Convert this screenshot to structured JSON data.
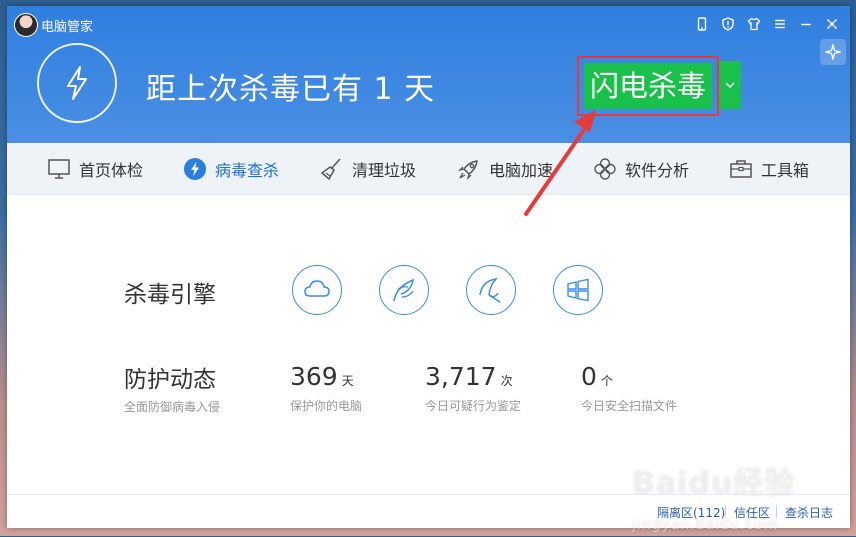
{
  "app": {
    "title": "电脑管家"
  },
  "status": {
    "text": "距上次杀毒已有 1 天"
  },
  "primary_action": {
    "label": "闪电杀毒"
  },
  "nav": [
    {
      "label": "首页体检",
      "icon": "monitor-icon"
    },
    {
      "label": "病毒查杀",
      "icon": "lightning-icon",
      "active": true
    },
    {
      "label": "清理垃圾",
      "icon": "broom-icon"
    },
    {
      "label": "电脑加速",
      "icon": "rocket-icon"
    },
    {
      "label": "软件分析",
      "icon": "flower-icon"
    },
    {
      "label": "工具箱",
      "icon": "toolbox-icon"
    }
  ],
  "engine": {
    "label": "杀毒引擎",
    "icons": [
      "cloud-icon",
      "feather-icon",
      "umbrella-icon",
      "windows-icon"
    ]
  },
  "protection": {
    "label": "防护动态",
    "sub": "全面防御病毒入侵",
    "stats": [
      {
        "value": "369",
        "unit": "天",
        "desc": "保护你的电脑"
      },
      {
        "value": "3,717",
        "unit": "次",
        "desc": "今日可疑行为鉴定"
      },
      {
        "value": "0",
        "unit": "个",
        "desc": "今日安全扫描文件"
      }
    ]
  },
  "footer": {
    "quarantine": "隔离区(112)",
    "trust": "信任区",
    "log": "查杀日志"
  },
  "watermark": {
    "text": "Baidu经验",
    "sub": "jingyan.baidu.com"
  },
  "colors": {
    "header": "#3a86e0",
    "accent_green": "#19c14a",
    "highlight_red": "#e83a3a",
    "link": "#2a5fb0"
  }
}
